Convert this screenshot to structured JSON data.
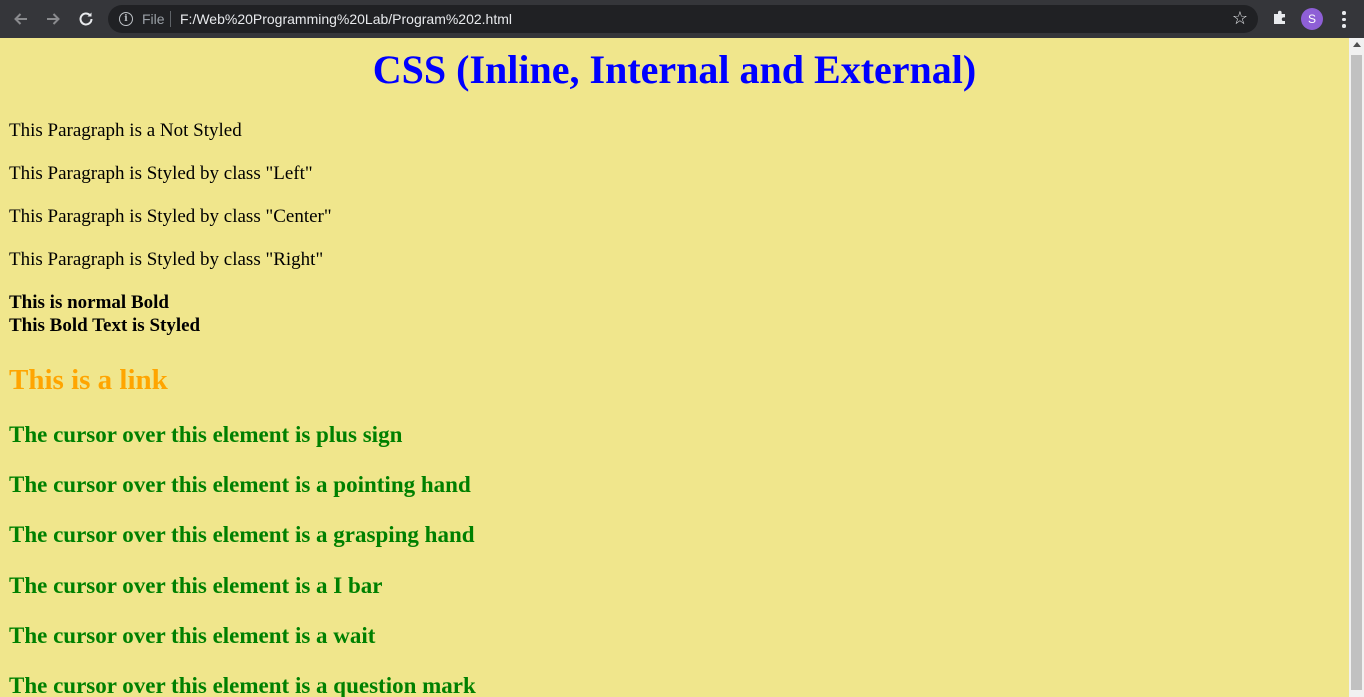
{
  "browser": {
    "scheme_label": "File",
    "url": "F:/Web%20Programming%20Lab/Program%202.html",
    "avatar_letter": "S",
    "icons": {
      "back": "arrow-left-icon",
      "forward": "arrow-right-icon",
      "reload": "reload-icon",
      "info": "info-icon",
      "bookmark": "star-icon",
      "extensions": "puzzle-icon",
      "menu": "kebab-menu-icon"
    }
  },
  "page": {
    "title": "CSS (Inline, Internal and External)",
    "paragraphs": [
      "This Paragraph is a Not Styled",
      "This Paragraph is Styled by class \"Left\"",
      "This Paragraph is Styled by class \"Center\"",
      "This Paragraph is Styled by class \"Right\""
    ],
    "bold_normal": "This is normal Bold",
    "bold_styled": "This Bold Text is Styled",
    "link_text": "This is a link",
    "cursor_lines": [
      "The cursor over this element is plus sign",
      "The cursor over this element is a pointing hand",
      "The cursor over this element is a grasping hand",
      "The cursor over this element is a I bar",
      "The cursor over this element is a wait",
      "The cursor over this element is a question mark"
    ]
  },
  "colors": {
    "page_background": "#f0e68c",
    "title": "#0000ff",
    "link": "#ffa500",
    "cursor_text": "#008000",
    "chrome_toolbar": "#35363a",
    "avatar": "#8e5fd6"
  }
}
